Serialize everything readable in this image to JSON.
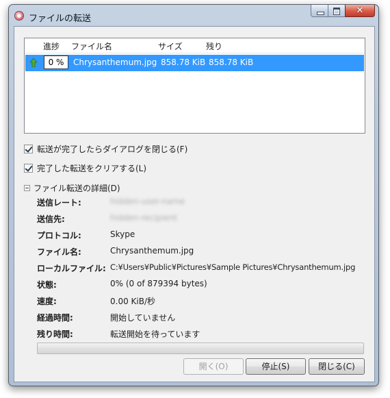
{
  "window": {
    "title": "ファイルの転送"
  },
  "transfer_list": {
    "columns": [
      "進捗",
      "ファイル名",
      "サイズ",
      "残り"
    ],
    "rows": [
      {
        "progress": "0 %",
        "file_name": "Chrysanthemum.jpg",
        "size": "858.78 KiB",
        "remaining": "858.78 KiB",
        "direction_icon": "upload-arrow-icon"
      }
    ]
  },
  "options": {
    "close_dialog_label": "転送が完了したらダイアログを閉じる(F)",
    "close_dialog_checked": true,
    "clear_completed_label": "完了した転送をクリアする(L)",
    "clear_completed_checked": true
  },
  "details": {
    "toggle_label": "ファイル転送の詳細(D)",
    "expanded": true,
    "rows": [
      {
        "label": "送信レート:",
        "value": "hidden-user-name",
        "blurred": true
      },
      {
        "label": "送信先:",
        "value": "hidden-recipient",
        "blurred": true
      },
      {
        "label": "プロトコル:",
        "value": "Skype"
      },
      {
        "label": "ファイル名:",
        "value": "Chrysanthemum.jpg"
      },
      {
        "label": "ローカルファイル:",
        "value": "C:¥Users¥Public¥Pictures¥Sample Pictures¥Chrysanthemum.jpg"
      },
      {
        "label": "状態:",
        "value": "0% (0 of 879394 bytes)"
      },
      {
        "label": "速度:",
        "value": "0.00 KiB/秒"
      },
      {
        "label": "経過時間:",
        "value": "開始していません"
      },
      {
        "label": "残り時間:",
        "value": "転送開始を待っています"
      }
    ]
  },
  "progress": {
    "fraction": 0
  },
  "buttons": {
    "open": "開く(O)",
    "open_enabled": false,
    "stop": "停止(S)",
    "close": "閉じる(C)"
  },
  "colors": {
    "selection": "#3399ff",
    "dialog_face": "#f0f0f0",
    "progress_fill": "#06b025",
    "close_button": "#c0392b"
  }
}
